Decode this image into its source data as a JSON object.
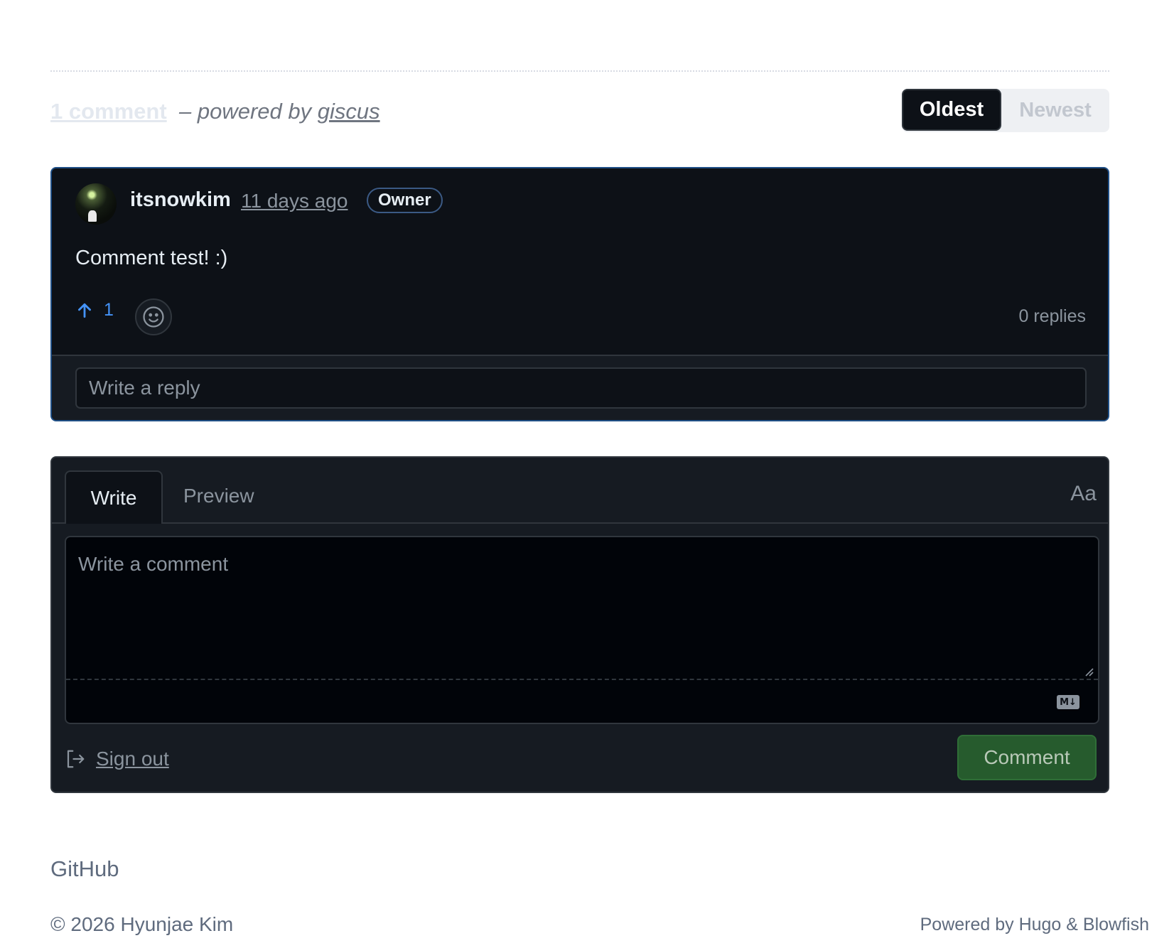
{
  "header": {
    "comment_count": "1 comment",
    "powered_prefix": "– powered by ",
    "powered_link": "giscus",
    "sort_options": [
      "Oldest",
      "Newest"
    ],
    "sort_selected": "Oldest"
  },
  "comment": {
    "author": "itsnowkim",
    "time": "11 days ago",
    "badge": "Owner",
    "body": "Comment test! :)",
    "upvotes": "1",
    "replies": "0 replies",
    "reply_placeholder": "Write a reply"
  },
  "editor": {
    "tabs": [
      "Write",
      "Preview"
    ],
    "active_tab": "Write",
    "font_toggle": "Aa",
    "placeholder": "Write a comment",
    "md_badge": "M↓",
    "sign_out": "Sign out",
    "submit": "Comment"
  },
  "footer": {
    "link": "GitHub",
    "copyright": "© 2026 Hyunjae Kim",
    "powered": "Powered by Hugo & Blowfish"
  },
  "colors": {
    "dark_bg": "#0d1117",
    "accent_blue": "#4493f8",
    "comment_green": "#265b2d"
  },
  "icons": {
    "upvote": "arrow-up-icon",
    "reaction": "smiley-icon",
    "sign_out": "sign-out-icon",
    "markdown": "markdown-icon"
  }
}
